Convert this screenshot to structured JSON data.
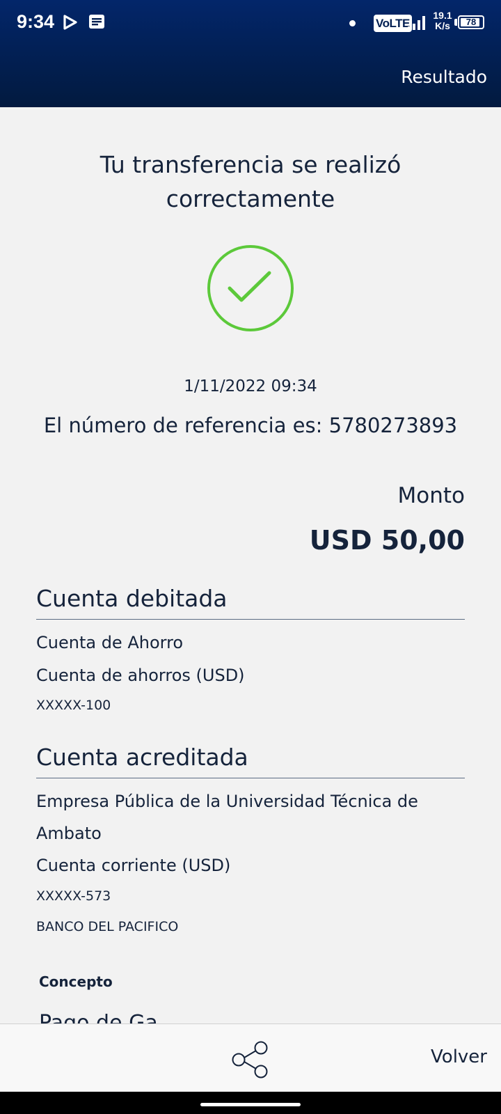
{
  "status_bar": {
    "time": "9:34",
    "network_type": "VoLTE",
    "net_rate_value": "19.1",
    "net_rate_unit": "K/s",
    "battery_level": "78",
    "icons": [
      "play-icon",
      "message-icon",
      "dot-icon",
      "signal-icon",
      "battery-icon"
    ]
  },
  "header": {
    "title": "Resultado",
    "background": "#021f52"
  },
  "result": {
    "message": "Tu transferencia se realizó correctamente",
    "status_icon": "check-circle-icon",
    "status_color": "#5cc93a",
    "datetime": "1/11/2022 09:34",
    "reference_text": "El número de referencia es: 5780273893"
  },
  "amount": {
    "label": "Monto",
    "value": "USD 50,00"
  },
  "debited": {
    "title": "Cuenta debitada",
    "account_name": "Cuenta de Ahorro",
    "account_type": "Cuenta de ahorros (USD)",
    "account_number": "XXXXX-100"
  },
  "credited": {
    "title": "Cuenta acreditada",
    "holder_line1": "Empresa Pública de la Universidad Técnica de",
    "holder_line2": "Ambato",
    "account_type": "Cuenta corriente (USD)",
    "account_number": "XXXXX-573",
    "bank": "BANCO DEL PACIFICO"
  },
  "concept": {
    "label": "Concepto",
    "value": "Pago de Ga"
  },
  "bottom_bar": {
    "share_icon": "share-icon",
    "back_label": "Volver"
  }
}
